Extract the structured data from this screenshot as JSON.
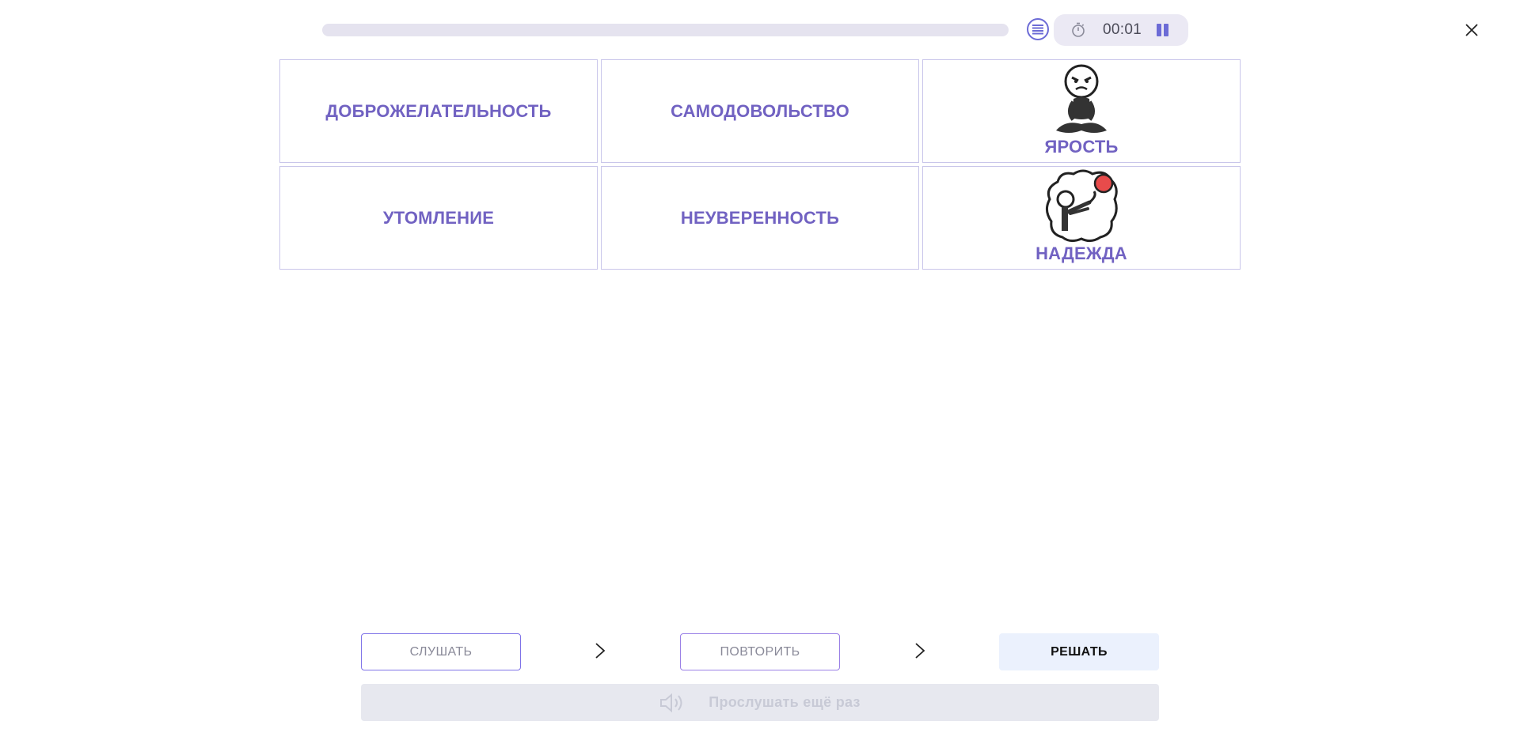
{
  "topbar": {
    "progress": 0,
    "timer": "00:01",
    "icons": {
      "list": "list-icon",
      "timer": "stopwatch-icon",
      "pause": "pause-icon",
      "close": "close-icon"
    }
  },
  "cards": [
    {
      "label": "ДОБРОЖЕЛАТЕЛЬНОСТЬ",
      "image": null
    },
    {
      "label": "САМОДОВОЛЬСТВО",
      "image": null
    },
    {
      "label": "ЯРОСТЬ",
      "image": "angry-meditating-figure"
    },
    {
      "label": "УТОМЛЕНИЕ",
      "image": null
    },
    {
      "label": "НЕУВЕРЕННОСТЬ",
      "image": null
    },
    {
      "label": "НАДЕЖДА",
      "image": "reaching-for-red-ball-figure"
    }
  ],
  "steps": {
    "listen": "СЛУШАТЬ",
    "repeat": "ПОВТОРИТЬ",
    "solve": "РЕШАТЬ"
  },
  "replay": {
    "label": "Прослушать ещё раз",
    "icon": "speaker-icon"
  },
  "colors": {
    "accent": "#6c6bd6",
    "card_text": "#7162c2",
    "card_border": "#c9c6ea",
    "solve_bg": "#ebf1fd",
    "replay_bg": "#e7e8ef",
    "figure_red": "#e84b4b"
  }
}
